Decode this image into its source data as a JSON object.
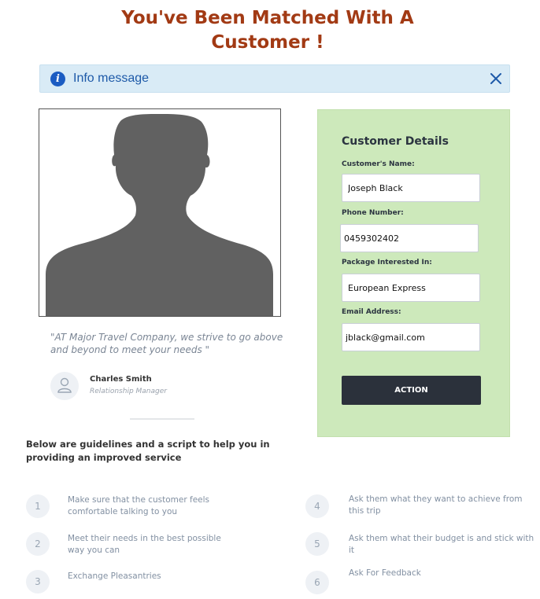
{
  "header": {
    "title_line1": "You've Been Matched With A",
    "title_line2": "Customer !"
  },
  "info_bar": {
    "icon": "info-icon",
    "message": "Info message",
    "close_icon": "close-icon",
    "colors": {
      "background": "#d9ebf6",
      "text": "#1d59a8"
    }
  },
  "photo": {
    "icon": "person-silhouette"
  },
  "testimonial": {
    "quote": "\"AT Major Travel Company, we strive to go above and beyond to meet your needs \"",
    "name": "Charles Smith",
    "role": "Relationship Manager"
  },
  "guidelines": {
    "heading": "Below are guidelines and a script to help you in providing an improved service",
    "steps": [
      {
        "number": "1",
        "text": "Make sure that the customer feels comfortable talking to you"
      },
      {
        "number": "2",
        "text": "Meet their needs in the best possible way you can"
      },
      {
        "number": "3",
        "text": "Exchange Pleasantries"
      },
      {
        "number": "4",
        "text": "Ask them what they want to achieve from this trip"
      },
      {
        "number": "5",
        "text": "Ask them what their budget is and stick with it"
      },
      {
        "number": "6",
        "text": "Ask For Feedback"
      }
    ]
  },
  "customer_details": {
    "title": "Customer Details",
    "name_label": "Customer's Name:",
    "name_value": "Joseph Black",
    "phone_label": "Phone Number:",
    "phone_value": "0459302402",
    "package_label": "Package Interested In:",
    "package_value": "European Express",
    "email_label": "Email Address:",
    "email_value": "jblack@gmail.com",
    "action_label": "ACTION",
    "colors": {
      "panel": "#cde9bb",
      "button": "#2b313b"
    }
  },
  "colors": {
    "title": "#a23a14"
  }
}
